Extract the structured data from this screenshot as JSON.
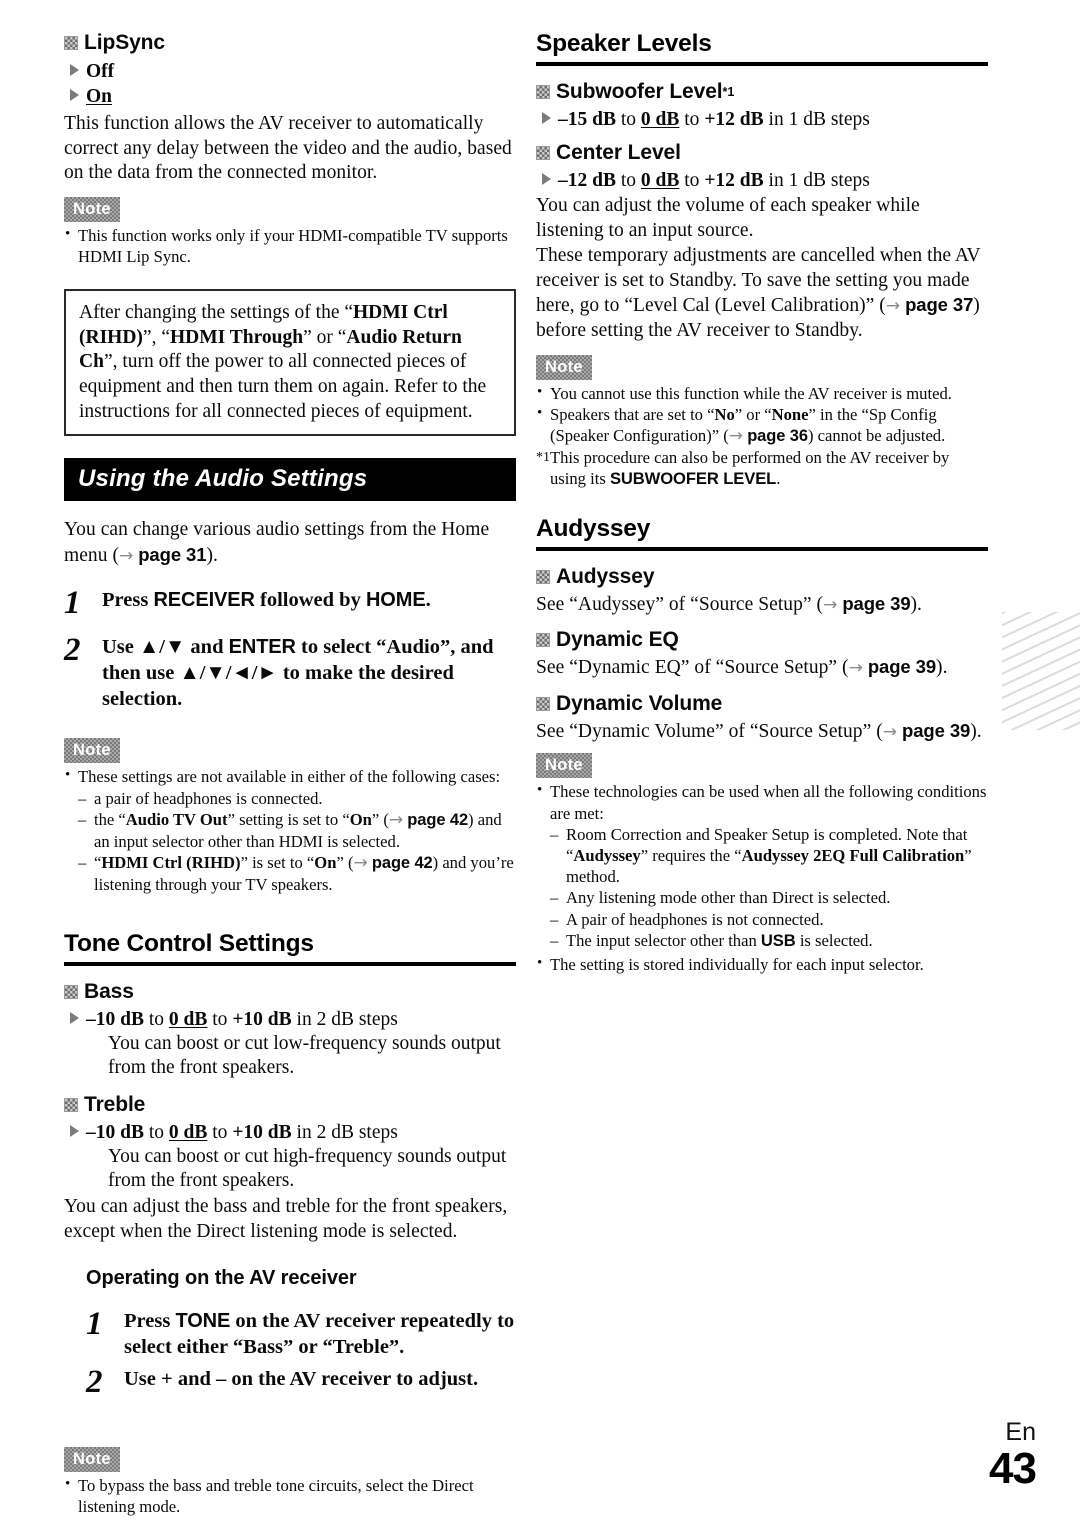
{
  "footer": {
    "language": "En",
    "page_number": "43"
  },
  "left_column": {
    "lipsync": {
      "heading": "LipSync",
      "options": [
        {
          "label": "Off",
          "default": false
        },
        {
          "label": "On",
          "default": true
        }
      ],
      "body": "This function allows the AV receiver to automatically correct any delay between the video and the audio, based on the data from the connected monitor.",
      "note": {
        "badge": "Note",
        "items": [
          "This function works only if your HDMI-compatible TV supports HDMI Lip Sync."
        ]
      }
    },
    "callout": {
      "text_1": "After changing the settings of the “",
      "bold_1": "HDMI Ctrl (RIHD)",
      "text_2": "”, “",
      "bold_2": "HDMI Through",
      "text_3": "” or “",
      "bold_3": "Audio Return Ch",
      "text_4": "”, turn off the power to all connected pieces of equipment and then turn them on again. Refer to the instructions for all connected pieces of equipment."
    },
    "audio_settings": {
      "banner": "Using the Audio Settings",
      "intro_text_1": "You can change various audio settings from the Home menu (",
      "intro_arrow": "→",
      "intro_page": "page 31",
      "intro_text_2": ").",
      "steps": [
        {
          "num": "1",
          "pre": "Press ",
          "key_1": "RECEIVER",
          "mid": " followed by ",
          "key_2": "HOME",
          "post": "."
        },
        {
          "num": "2",
          "pre": "Use ",
          "key_1": "▲/▼",
          "mid": " and ",
          "key_2": "ENTER",
          "post": " to select “Audio”, and then use ",
          "key_3": "▲/▼/◄/►",
          "tail": " to make the desired selection."
        }
      ],
      "note": {
        "badge": "Note",
        "lead": "These settings are not available in either of the following cases:",
        "items": [
          {
            "text": "a pair of headphones is connected."
          },
          {
            "pre": "the “",
            "bold_1": "Audio TV Out",
            "mid_1": "” setting is set to “",
            "bold_2": "On",
            "mid_2": "” (",
            "arrow": "→",
            "page": "page 42",
            "post": ") and an input selector other than HDMI is selected."
          },
          {
            "pre": "“",
            "bold_1": "HDMI Ctrl (RIHD)",
            "mid_1": "” is set to “",
            "bold_2": "On",
            "mid_2": "” (",
            "arrow": "→",
            "page": "page 42",
            "post": ") and you’re listening through your TV speakers."
          }
        ]
      }
    },
    "tone_control": {
      "heading": "Tone Control Settings",
      "bass": {
        "heading": "Bass",
        "range_min": "–10 dB",
        "range_to_1": " to ",
        "range_default": "0 dB",
        "range_to_2": " to ",
        "range_max": "+10 dB",
        "range_steps": " in 2 dB steps",
        "description": "You can boost or cut low-frequency sounds output from the front speakers."
      },
      "treble": {
        "heading": "Treble",
        "range_min": "–10 dB",
        "range_to_1": " to ",
        "range_default": "0 dB",
        "range_to_2": " to ",
        "range_max": "+10 dB",
        "range_steps": " in 2 dB steps",
        "description": "You can boost or cut high-frequency sounds output from the front speakers."
      },
      "body": "You can adjust the bass and treble for the front speakers, except when the Direct listening mode is selected.",
      "operating_heading": "Operating on the AV receiver",
      "steps": [
        {
          "num": "1",
          "pre": "Press ",
          "key_1": "TONE",
          "post": " on the AV receiver repeatedly to select either “Bass” or “Treble”."
        },
        {
          "num": "2",
          "pre": "Use + and – on the AV receiver to adjust.",
          "key_1": "",
          "post": ""
        }
      ],
      "note": {
        "badge": "Note",
        "items": [
          "To bypass the bass and treble tone circuits, select the Direct listening mode."
        ]
      }
    }
  },
  "right_column": {
    "speaker_levels": {
      "heading": "Speaker Levels",
      "subwoofer": {
        "heading": "Subwoofer Level",
        "footnote_marker": "*1",
        "range_min": "–15 dB",
        "range_to_1": " to ",
        "range_default": "0 dB",
        "range_to_2": " to ",
        "range_max": "+12 dB",
        "range_steps": " in 1 dB steps"
      },
      "center": {
        "heading": "Center Level",
        "range_min": "–12 dB",
        "range_to_1": " to ",
        "range_default": "0 dB",
        "range_to_2": " to ",
        "range_max": "+12 dB",
        "range_steps": " in 1 dB steps"
      },
      "body_1": "You can adjust the volume of each speaker while listening to an input source.",
      "body_2_pre": "These temporary adjustments are cancelled when the AV receiver is set to Standby. To save the setting you made here, go to “Level Cal (Level Calibration)” (",
      "body_2_arrow": "→",
      "body_2_page": "page 37",
      "body_2_post": ") before setting the AV receiver to Standby.",
      "note": {
        "badge": "Note",
        "item_1": "You cannot use this function while the AV receiver is muted.",
        "item_2_pre": "Speakers that are set to “",
        "item_2_bold_1": "No",
        "item_2_mid": "” or “",
        "item_2_bold_2": "None",
        "item_2_post": "” in the “Sp Config (Speaker Configuration)” (",
        "item_2_arrow": "→",
        "item_2_page": "page 36",
        "item_2_tail": ") cannot be adjusted.",
        "footnote_marker": "*1",
        "footnote_pre": "This procedure can also be performed on the AV receiver by using its ",
        "footnote_key": "SUBWOOFER LEVEL",
        "footnote_post": "."
      }
    },
    "audyssey": {
      "heading": "Audyssey",
      "entries": [
        {
          "heading": "Audyssey",
          "pre": "See “Audyssey” of “Source Setup” (",
          "arrow": "→",
          "page": "page 39",
          "post": ")."
        },
        {
          "heading": "Dynamic EQ",
          "pre": "See “Dynamic EQ” of “Source Setup” (",
          "arrow": "→",
          "page": "page 39",
          "post": ")."
        },
        {
          "heading": "Dynamic Volume",
          "pre": "See “Dynamic Volume” of “Source Setup” (",
          "arrow": "→",
          "page": "page 39",
          "post": ")."
        }
      ],
      "note": {
        "badge": "Note",
        "lead": "These technologies can be used when all the following conditions are met:",
        "item_1_pre": "Room Correction and Speaker Setup is completed. Note that “",
        "item_1_bold_1": "Audyssey",
        "item_1_mid": "” requires the “",
        "item_1_bold_2": "Audyssey 2EQ Full Calibration",
        "item_1_post": "” method.",
        "item_2": "Any listening mode other than Direct is selected.",
        "item_3": "A pair of headphones is not connected.",
        "item_4_pre": "The input selector other than ",
        "item_4_key": "USB",
        "item_4_post": " is selected.",
        "item_5": "The setting is stored individually for each input selector."
      }
    }
  }
}
